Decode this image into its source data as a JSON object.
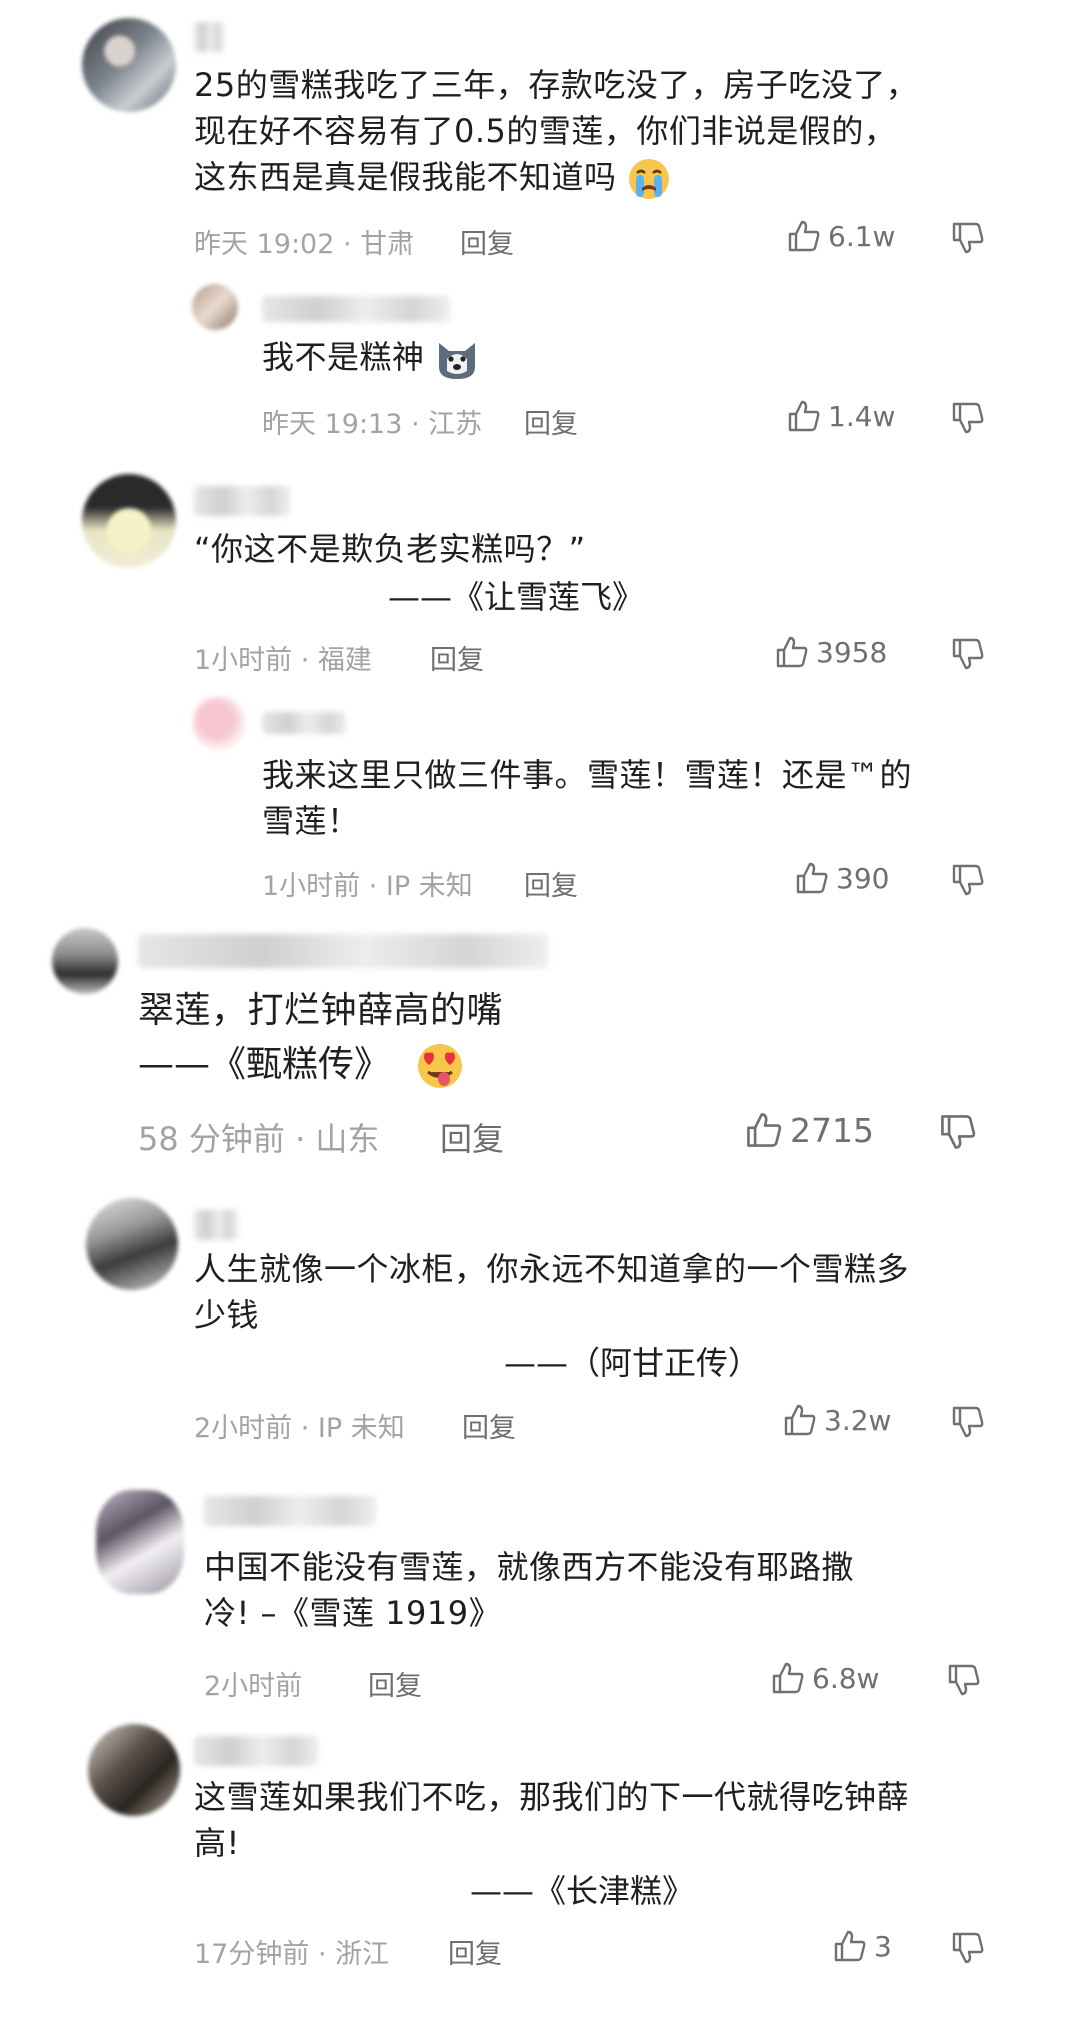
{
  "comments": [
    {
      "lines": [
        "25的雪糕我吃了三年，存款吃没了，房子吃没了，",
        "现在好不容易有了0.5的雪莲，你们非说是假的，",
        "这东西是真是假我能不知道吗"
      ],
      "emoji": "crying-face",
      "time_location": "昨天 19:02 · 甘肃",
      "reply_label": "回复",
      "likes": "6.1w",
      "replies": [
        {
          "lines": [
            "我不是糕神"
          ],
          "emoji": "husky-dog-face",
          "time_location": "昨天 19:13 · 江苏",
          "reply_label": "回复",
          "likes": "1.4w"
        }
      ]
    },
    {
      "lines": [
        "“你这不是欺负老实糕吗？”"
      ],
      "quote": "——《让雪莲飞》",
      "time_location": "1小时前 · 福建",
      "reply_label": "回复",
      "likes": "3958",
      "replies": [
        {
          "lines": [
            "我来这里只做三件事。雪莲！雪莲！还是™的",
            "雪莲！"
          ],
          "time_location": "1小时前 · IP 未知",
          "reply_label": "回复",
          "likes": "390"
        }
      ]
    },
    {
      "lines": [
        "翠莲，打烂钟薛高的嘴"
      ],
      "quote": "——《甄糕传》",
      "emoji": "heart-eyes-tongue-face",
      "time_location": "58 分钟前 · 山东",
      "reply_label": "回复",
      "likes": "2715"
    },
    {
      "lines": [
        "人生就像一个冰柜，你永远不知道拿的一个雪糕多",
        "少钱"
      ],
      "quote": "——（阿甘正传）",
      "time_location": "2小时前 · IP 未知",
      "reply_label": "回复",
      "likes": "3.2w"
    },
    {
      "lines": [
        "中国不能没有雪莲，就像西方不能没有耶路撒",
        "冷! –《雪莲 1919》"
      ],
      "time_location": "2小时前",
      "reply_label": "回复",
      "likes": "6.8w"
    },
    {
      "lines": [
        "这雪莲如果我们不吃，那我们的下一代就得吃钟薛",
        "高!"
      ],
      "quote": "——《长津糕》",
      "time_location": "17分钟前 · 浙江",
      "reply_label": "回复",
      "likes": "3"
    }
  ],
  "icons": {
    "like": "thumbs-up-outline-icon",
    "dislike": "thumbs-down-outline-icon"
  },
  "colors": {
    "text": "#1f1f1f",
    "meta": "#a3a3a3",
    "icon": "#707070"
  }
}
